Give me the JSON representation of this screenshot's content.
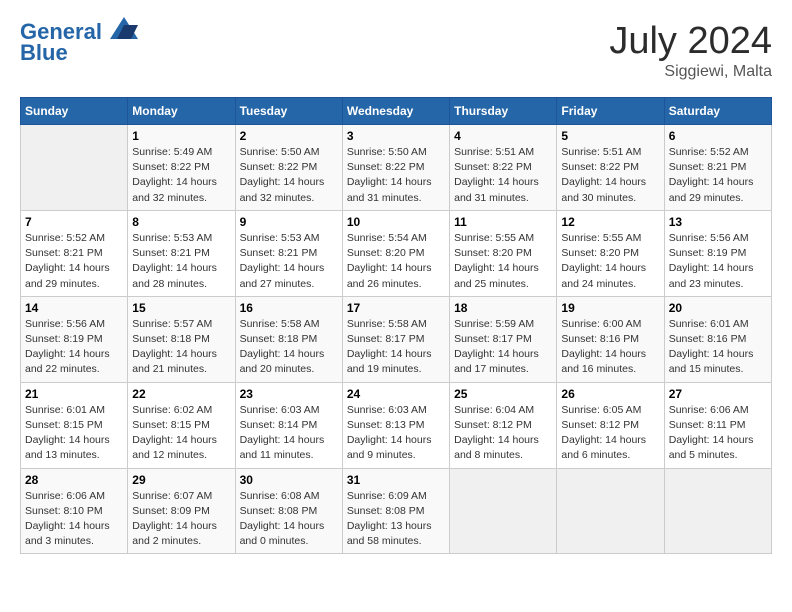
{
  "header": {
    "logo_line1": "General",
    "logo_line2": "Blue",
    "month": "July 2024",
    "location": "Siggiewi, Malta"
  },
  "columns": [
    "Sunday",
    "Monday",
    "Tuesday",
    "Wednesday",
    "Thursday",
    "Friday",
    "Saturday"
  ],
  "weeks": [
    [
      {
        "day": "",
        "info": ""
      },
      {
        "day": "1",
        "info": "Sunrise: 5:49 AM\nSunset: 8:22 PM\nDaylight: 14 hours\nand 32 minutes."
      },
      {
        "day": "2",
        "info": "Sunrise: 5:50 AM\nSunset: 8:22 PM\nDaylight: 14 hours\nand 32 minutes."
      },
      {
        "day": "3",
        "info": "Sunrise: 5:50 AM\nSunset: 8:22 PM\nDaylight: 14 hours\nand 31 minutes."
      },
      {
        "day": "4",
        "info": "Sunrise: 5:51 AM\nSunset: 8:22 PM\nDaylight: 14 hours\nand 31 minutes."
      },
      {
        "day": "5",
        "info": "Sunrise: 5:51 AM\nSunset: 8:22 PM\nDaylight: 14 hours\nand 30 minutes."
      },
      {
        "day": "6",
        "info": "Sunrise: 5:52 AM\nSunset: 8:21 PM\nDaylight: 14 hours\nand 29 minutes."
      }
    ],
    [
      {
        "day": "7",
        "info": "Sunrise: 5:52 AM\nSunset: 8:21 PM\nDaylight: 14 hours\nand 29 minutes."
      },
      {
        "day": "8",
        "info": "Sunrise: 5:53 AM\nSunset: 8:21 PM\nDaylight: 14 hours\nand 28 minutes."
      },
      {
        "day": "9",
        "info": "Sunrise: 5:53 AM\nSunset: 8:21 PM\nDaylight: 14 hours\nand 27 minutes."
      },
      {
        "day": "10",
        "info": "Sunrise: 5:54 AM\nSunset: 8:20 PM\nDaylight: 14 hours\nand 26 minutes."
      },
      {
        "day": "11",
        "info": "Sunrise: 5:55 AM\nSunset: 8:20 PM\nDaylight: 14 hours\nand 25 minutes."
      },
      {
        "day": "12",
        "info": "Sunrise: 5:55 AM\nSunset: 8:20 PM\nDaylight: 14 hours\nand 24 minutes."
      },
      {
        "day": "13",
        "info": "Sunrise: 5:56 AM\nSunset: 8:19 PM\nDaylight: 14 hours\nand 23 minutes."
      }
    ],
    [
      {
        "day": "14",
        "info": "Sunrise: 5:56 AM\nSunset: 8:19 PM\nDaylight: 14 hours\nand 22 minutes."
      },
      {
        "day": "15",
        "info": "Sunrise: 5:57 AM\nSunset: 8:18 PM\nDaylight: 14 hours\nand 21 minutes."
      },
      {
        "day": "16",
        "info": "Sunrise: 5:58 AM\nSunset: 8:18 PM\nDaylight: 14 hours\nand 20 minutes."
      },
      {
        "day": "17",
        "info": "Sunrise: 5:58 AM\nSunset: 8:17 PM\nDaylight: 14 hours\nand 19 minutes."
      },
      {
        "day": "18",
        "info": "Sunrise: 5:59 AM\nSunset: 8:17 PM\nDaylight: 14 hours\nand 17 minutes."
      },
      {
        "day": "19",
        "info": "Sunrise: 6:00 AM\nSunset: 8:16 PM\nDaylight: 14 hours\nand 16 minutes."
      },
      {
        "day": "20",
        "info": "Sunrise: 6:01 AM\nSunset: 8:16 PM\nDaylight: 14 hours\nand 15 minutes."
      }
    ],
    [
      {
        "day": "21",
        "info": "Sunrise: 6:01 AM\nSunset: 8:15 PM\nDaylight: 14 hours\nand 13 minutes."
      },
      {
        "day": "22",
        "info": "Sunrise: 6:02 AM\nSunset: 8:15 PM\nDaylight: 14 hours\nand 12 minutes."
      },
      {
        "day": "23",
        "info": "Sunrise: 6:03 AM\nSunset: 8:14 PM\nDaylight: 14 hours\nand 11 minutes."
      },
      {
        "day": "24",
        "info": "Sunrise: 6:03 AM\nSunset: 8:13 PM\nDaylight: 14 hours\nand 9 minutes."
      },
      {
        "day": "25",
        "info": "Sunrise: 6:04 AM\nSunset: 8:12 PM\nDaylight: 14 hours\nand 8 minutes."
      },
      {
        "day": "26",
        "info": "Sunrise: 6:05 AM\nSunset: 8:12 PM\nDaylight: 14 hours\nand 6 minutes."
      },
      {
        "day": "27",
        "info": "Sunrise: 6:06 AM\nSunset: 8:11 PM\nDaylight: 14 hours\nand 5 minutes."
      }
    ],
    [
      {
        "day": "28",
        "info": "Sunrise: 6:06 AM\nSunset: 8:10 PM\nDaylight: 14 hours\nand 3 minutes."
      },
      {
        "day": "29",
        "info": "Sunrise: 6:07 AM\nSunset: 8:09 PM\nDaylight: 14 hours\nand 2 minutes."
      },
      {
        "day": "30",
        "info": "Sunrise: 6:08 AM\nSunset: 8:08 PM\nDaylight: 14 hours\nand 0 minutes."
      },
      {
        "day": "31",
        "info": "Sunrise: 6:09 AM\nSunset: 8:08 PM\nDaylight: 13 hours\nand 58 minutes."
      },
      {
        "day": "",
        "info": ""
      },
      {
        "day": "",
        "info": ""
      },
      {
        "day": "",
        "info": ""
      }
    ]
  ]
}
